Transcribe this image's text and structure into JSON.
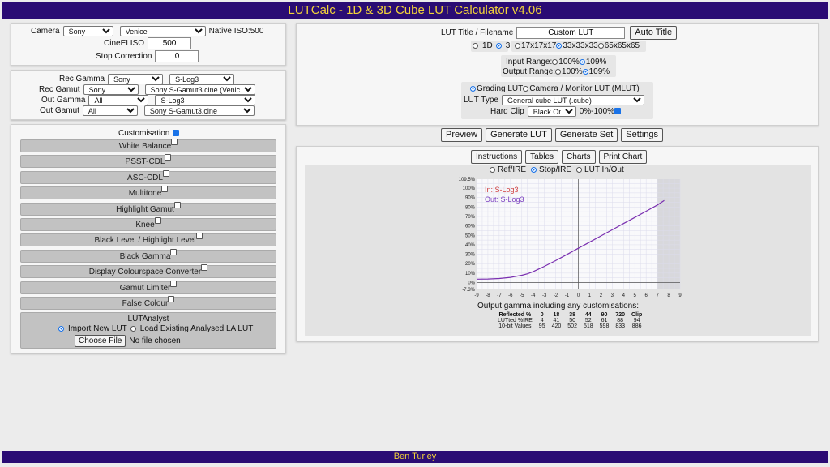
{
  "title": "LUTCalc - 1D & 3D Cube LUT Calculator v4.06",
  "footer": "Ben Turley",
  "camera": {
    "label": "Camera",
    "make": "Sony",
    "model": "Venice",
    "native_iso": "Native ISO:500",
    "cineei_label": "CineEI ISO",
    "cineei_value": "500",
    "stop_label": "Stop Correction",
    "stop_value": "0"
  },
  "gamma": {
    "rec_gamma_label": "Rec Gamma",
    "rec_gamma_make": "Sony",
    "rec_gamma": "S-Log3",
    "rec_gamut_label": "Rec Gamut",
    "rec_gamut_make": "Sony",
    "rec_gamut": "Sony S-Gamut3.cine (Venice)",
    "out_gamma_label": "Out Gamma",
    "out_gamma_make": "All",
    "out_gamma": "S-Log3",
    "out_gamut_label": "Out Gamut",
    "out_gamut_make": "All",
    "out_gamut": "Sony S-Gamut3.cine"
  },
  "custom": {
    "label": "Customisation",
    "bars": [
      "White Balance",
      "PSST-CDL",
      "ASC-CDL",
      "Multitone",
      "Highlight Gamut",
      "Knee",
      "Black Level / Highlight Level",
      "Black Gamma",
      "Display Colourspace Converter",
      "Gamut Limiter",
      "False Colour"
    ],
    "lutanalyst": {
      "title": "LUTAnalyst",
      "opt1": "Import New LUT",
      "opt2": "Load Existing Analysed LA LUT",
      "choose": "Choose File",
      "nofile": "No file chosen"
    }
  },
  "lut": {
    "title_label": "LUT Title / Filename",
    "title_value": "Custom LUT",
    "auto_title": "Auto Title",
    "dim_1d": "1D",
    "dim_3d": "3D",
    "size_17": "17x17x17",
    "size_33": "33x33x33",
    "size_65": "65x65x65",
    "input_range_label": "Input Range:",
    "output_range_label": "Output Range:",
    "r100": "100%",
    "r109": "109%",
    "grading": "Grading LUT",
    "camera_mlut": "Camera / Monitor LUT (MLUT)",
    "type_label": "LUT Type",
    "type_value": "General cube LUT (.cube)",
    "hardclip_label": "Hard Clip",
    "hardclip_value": "Black Only",
    "hardclip_range": "0%-100%"
  },
  "actions": [
    "Preview",
    "Generate LUT",
    "Generate Set",
    "Settings"
  ],
  "tabs": [
    "Instructions",
    "Tables",
    "Charts",
    "Print Chart"
  ],
  "chart_modes": [
    "Ref/IRE",
    "Stop/IRE",
    "LUT In/Out"
  ],
  "chart_data": {
    "type": "line",
    "legend": [
      "In: S-Log3",
      "Out: S-Log3"
    ],
    "legend_colors": [
      "#d04040",
      "#7a3fc0"
    ],
    "line_color": "#7a2fb0",
    "xlim": [
      -9,
      9
    ],
    "ylim": [
      -7.3,
      109.5
    ],
    "xticks": [
      -9,
      -8,
      -7,
      -6,
      -5,
      -4,
      -3,
      -2,
      -1,
      0,
      1,
      2,
      3,
      4,
      5,
      6,
      7,
      8,
      9
    ],
    "yticks": [
      -7.3,
      0,
      10,
      20,
      30,
      40,
      50,
      60,
      70,
      80,
      90,
      100,
      109.5
    ],
    "ytick_labels": [
      "-7.3%",
      "0%",
      "10%",
      "20%",
      "30%",
      "40%",
      "50%",
      "60%",
      "70%",
      "80%",
      "90%",
      "100%",
      "109.5%"
    ],
    "x": [
      -9,
      -8,
      -7,
      -6,
      -5,
      -4.5,
      -4,
      -3.5,
      -3,
      -2,
      -1,
      0,
      1,
      2,
      3,
      4,
      5,
      6,
      7,
      7.6
    ],
    "y": [
      3.6,
      3.8,
      4.3,
      5.5,
      7.7,
      9.3,
      11.5,
      14.3,
      17.2,
      23.3,
      29.8,
      36.3,
      42.8,
      49.4,
      55.9,
      62.5,
      69.0,
      75.6,
      82.2,
      87.0
    ],
    "clip_region": "shaded above 7 stops",
    "caption": "Output gamma including any customisations:"
  },
  "table": {
    "headers": [
      "Reflected %",
      "0",
      "18",
      "38",
      "44",
      "90",
      "720",
      "Clip"
    ],
    "rows": [
      [
        "LUTted %IRE",
        "4",
        "41",
        "50",
        "52",
        "61",
        "88",
        "94"
      ],
      [
        "10-bit Values",
        "95",
        "420",
        "502",
        "518",
        "598",
        "833",
        "886"
      ]
    ]
  }
}
